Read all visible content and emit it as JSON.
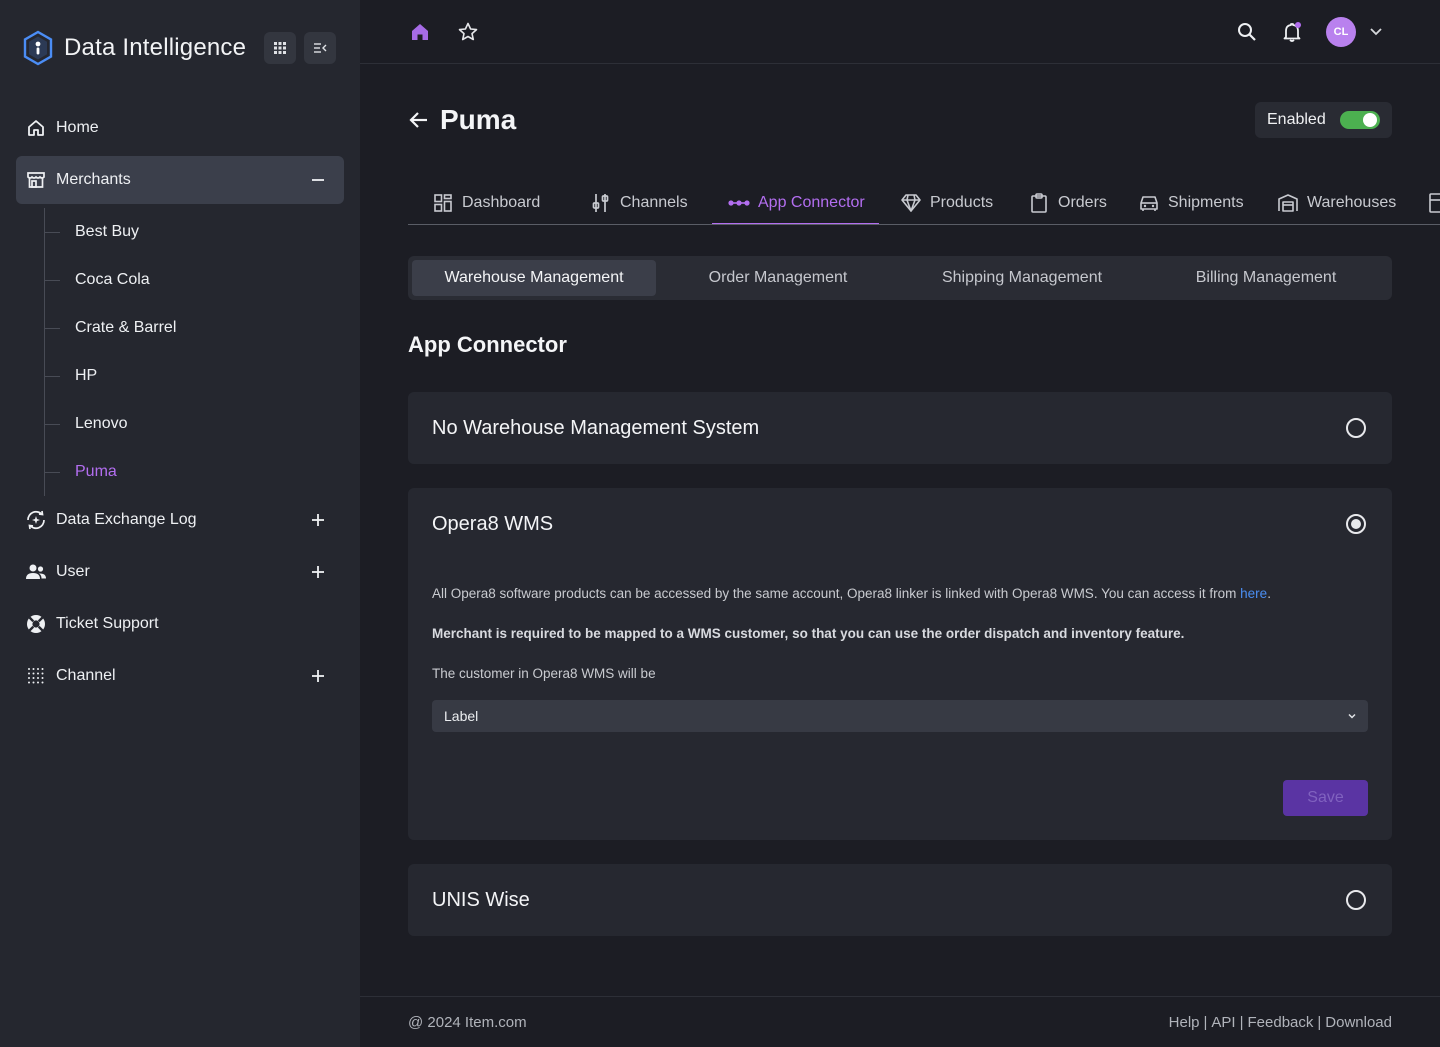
{
  "brand": {
    "name": "Data Intelligence"
  },
  "sidebar": {
    "items": [
      {
        "label": "Home"
      },
      {
        "label": "Merchants"
      },
      {
        "label": "Data Exchange Log"
      },
      {
        "label": "User"
      },
      {
        "label": "Ticket Support"
      },
      {
        "label": "Channel"
      }
    ],
    "merchants": [
      "Best Buy",
      "Coca Cola",
      "Crate & Barrel",
      "HP",
      "Lenovo",
      "Puma"
    ]
  },
  "topbar": {
    "avatar_initials": "CL"
  },
  "page": {
    "title": "Puma",
    "enabled_label": "Enabled",
    "enabled": true
  },
  "tabs": [
    "Dashboard",
    "Channels",
    "App Connector",
    "Products",
    "Orders",
    "Shipments",
    "Warehouses"
  ],
  "subtabs": [
    "Warehouse Management",
    "Order Management",
    "Shipping Management",
    "Billing Management"
  ],
  "section": {
    "title": "App Connector"
  },
  "options": {
    "none": {
      "title": "No Warehouse Management System"
    },
    "opera8": {
      "title": "Opera8 WMS",
      "desc_prefix": "All Opera8 software products can be accessed by the same account, Opera8 linker is linked with Opera8 WMS. You can access it from ",
      "desc_link": "here",
      "desc_suffix": ".",
      "required_note": "Merchant is required to be mapped to a WMS customer, so that you can use the order dispatch and inventory feature.",
      "customer_label": "The customer in Opera8 WMS will be",
      "select_value": "Label",
      "save_label": "Save"
    },
    "unis": {
      "title": "UNIS Wise"
    }
  },
  "footer": {
    "copyright": "@ 2024 Item.com",
    "links": [
      "Help",
      "API",
      "Feedback",
      "Download"
    ]
  },
  "colors": {
    "accent": "#b36ef0",
    "toggle_on": "#4cb050",
    "link": "#4a8ef2"
  }
}
